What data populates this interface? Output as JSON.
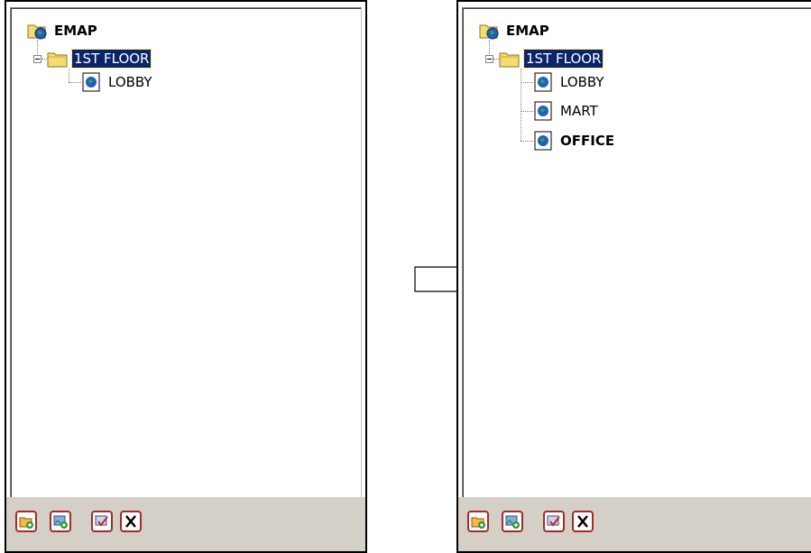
{
  "panels": [
    {
      "root": {
        "label": "EMAP",
        "icon": "folder-globe-icon"
      },
      "floor": {
        "label": "1ST FLOOR",
        "icon": "folder-icon",
        "selected": true
      },
      "maps": [
        {
          "label": "LOBBY",
          "icon": "map-globe-icon",
          "bold": false
        }
      ]
    },
    {
      "root": {
        "label": "EMAP",
        "icon": "folder-globe-icon"
      },
      "floor": {
        "label": "1ST FLOOR",
        "icon": "folder-icon",
        "selected": true
      },
      "maps": [
        {
          "label": "LOBBY",
          "icon": "map-globe-icon",
          "bold": false
        },
        {
          "label": "MART",
          "icon": "map-globe-icon",
          "bold": false
        },
        {
          "label": "OFFICE",
          "icon": "map-globe-icon",
          "bold": true
        }
      ]
    }
  ],
  "toolbar_buttons": [
    "add-folder-icon",
    "add-map-icon",
    "edit-map-icon",
    "delete-icon"
  ],
  "colors": {
    "selection": "#0a246a",
    "toolbar": "#d4d0c8",
    "button_border": "#a52a2a"
  }
}
